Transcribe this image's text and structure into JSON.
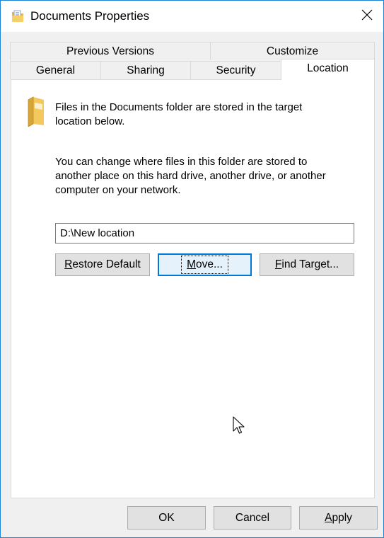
{
  "window": {
    "title": "Documents Properties"
  },
  "tabs": {
    "row1": [
      {
        "label": "Previous Versions"
      },
      {
        "label": "Customize"
      }
    ],
    "row2": [
      {
        "label": "General"
      },
      {
        "label": "Sharing"
      },
      {
        "label": "Security"
      },
      {
        "label": "Location"
      }
    ],
    "active": "Location"
  },
  "location": {
    "info_line1": "Files in the Documents folder are stored in the target",
    "info_line2": "location below.",
    "desc_line1": "You can change where files in this folder are stored to",
    "desc_line2": "another place on this hard drive, another drive, or another",
    "desc_line3": "computer on your network.",
    "path_value": "D:\\New location",
    "restore_first": "R",
    "restore_rest": "estore Default",
    "move_first": "M",
    "move_rest": "ove...",
    "find_first": "F",
    "find_rest": "ind Target..."
  },
  "footer": {
    "ok_label": "OK",
    "cancel_label": "Cancel",
    "apply_first": "A",
    "apply_rest": "pply"
  },
  "icons": {
    "title": "folder-documents-icon",
    "close": "close-icon",
    "folder": "folder-icon",
    "cursor": "mouse-pointer-icon"
  }
}
